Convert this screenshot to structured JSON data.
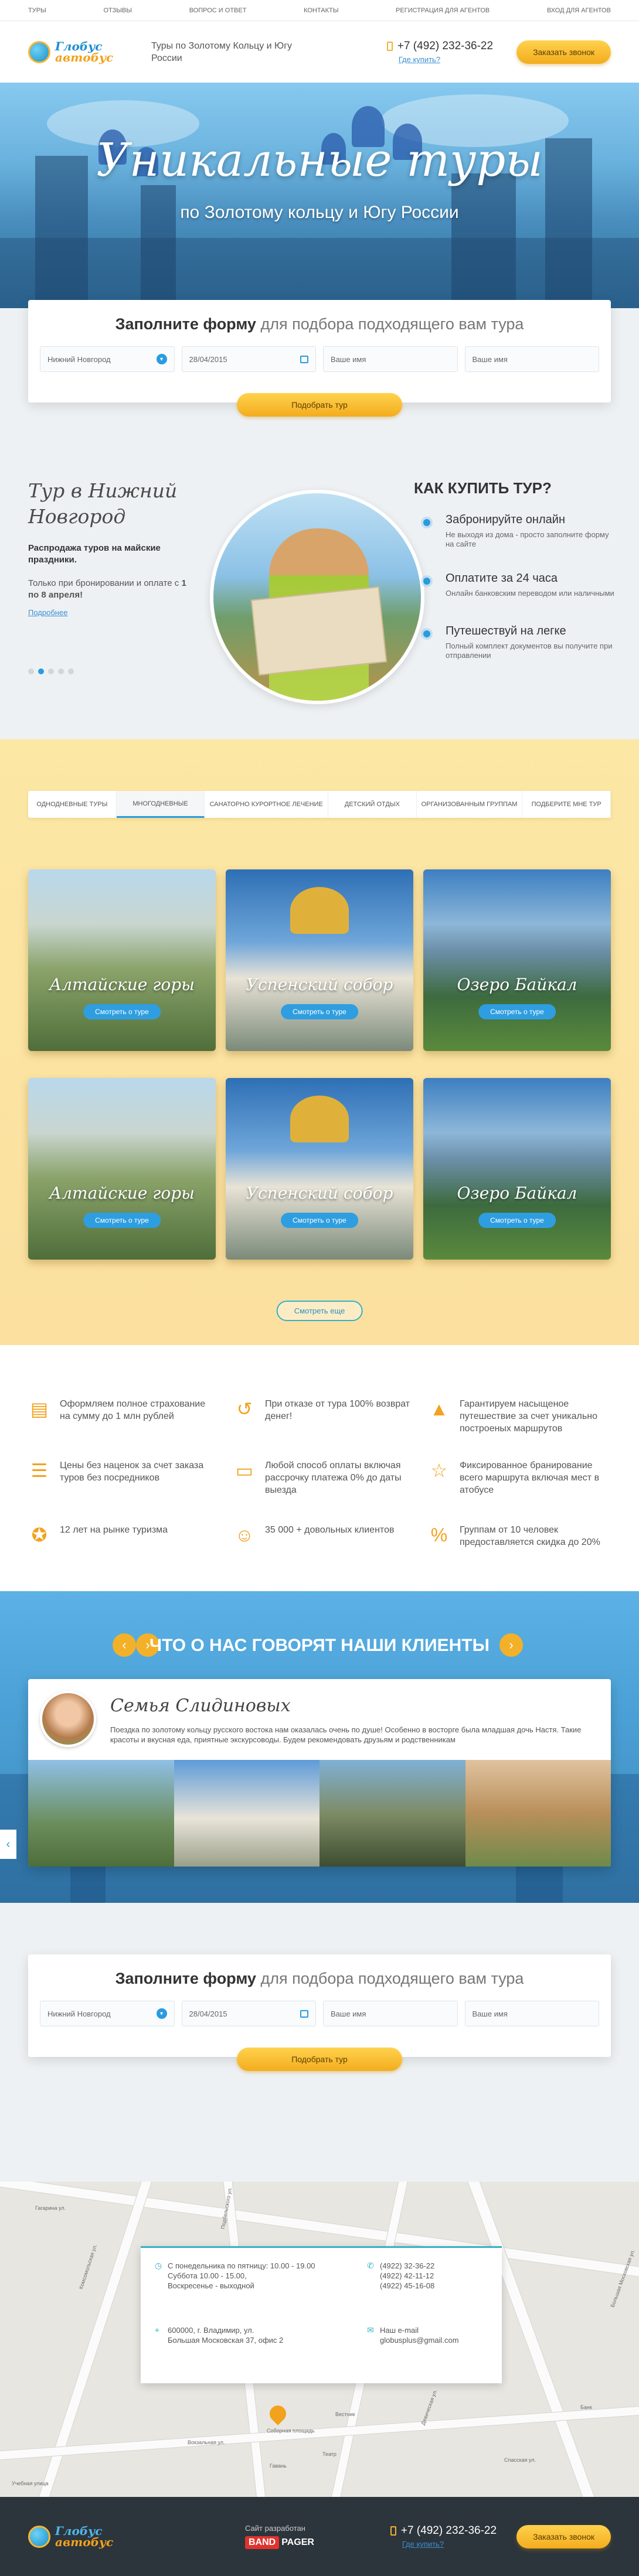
{
  "topnav": [
    "Туры",
    "Отзывы",
    "Вопрос и ответ",
    "Контакты",
    "Регистрация для агентов",
    "Вход для агентов"
  ],
  "header": {
    "logo_line1": "Глобус",
    "logo_line2": "автобус",
    "tagline": "Туры по Золотому Кольцу и Югу России",
    "phone": "+7 (492) 232-36-22",
    "where_link": "Где купить?",
    "callback": "Заказать звонок"
  },
  "hero": {
    "title": "Уникальные туры",
    "subtitle": "по Золотому кольцу и Югу России"
  },
  "form": {
    "title_bold": "Заполните форму",
    "title_rest": "для подбора подходящего вам тура",
    "city": "Нижний Новгород",
    "date": "28/04/2015",
    "name_placeholder": "Ваше имя",
    "name2_placeholder": "Ваше имя",
    "submit": "Подобрать тур"
  },
  "promo": {
    "title": "Тур в Нижний Новгород",
    "bold": "Распродажа туров на майские праздники.",
    "text_before": "Только при  бронировании и оплате с ",
    "text_bold": "1 по 8 апреля!",
    "link": "Подробнее",
    "how_title": "КАК КУПИТЬ ТУР?",
    "steps": [
      {
        "title": "Забронируйте онлайн",
        "desc": "Не выходя из дома - просто заполните форму на сайте"
      },
      {
        "title": "Оплатите за 24 часа",
        "desc": "Онлайн банковским переводом или наличными"
      },
      {
        "title": "Путешествуй на легке",
        "desc": "Полный комплект документов вы получите при отправлении"
      }
    ]
  },
  "tours": {
    "tabs": [
      "Однодневные туры",
      "Многодневные",
      "Санаторно курортное лечение",
      "Детский отдых",
      "Организованным группам",
      "Подберите мне тур"
    ],
    "active_tab": 1,
    "cards": [
      {
        "name": "Алтайские горы",
        "button": "Смотреть о туре"
      },
      {
        "name": "Успенский собор",
        "button": "Смотреть о туре"
      },
      {
        "name": "Озеро Байкал",
        "button": "Смотреть о туре"
      },
      {
        "name": "Алтайские горы",
        "button": "Смотреть о туре"
      },
      {
        "name": "Успенский собор",
        "button": "Смотреть о туре"
      },
      {
        "name": "Озеро Байкал",
        "button": "Смотреть о туре"
      }
    ],
    "more": "Смотреть еще"
  },
  "features": [
    {
      "icon": "document-icon",
      "text": "Оформляем полное страхование на сумму до 1 млн рублей"
    },
    {
      "icon": "refund-icon",
      "text": "При отказе от тура 100% возврат денег!"
    },
    {
      "icon": "mountain-icon",
      "text": "Гарантируем насыщеное путешествие за счет уникально построеных маршрутов"
    },
    {
      "icon": "receipt-icon",
      "text": "Цены без наценок за счет заказа туров без посредников"
    },
    {
      "icon": "wallet-icon",
      "text": "Любой способ оплаты включая рассрочку платежа 0% до даты выезда"
    },
    {
      "icon": "star-icon",
      "text": "Фиксированное бранирование всего маршрута включая мест в атобусе"
    },
    {
      "icon": "medal-icon",
      "text": "12 лет на рынке туризма"
    },
    {
      "icon": "smile-icon",
      "text": "35 000 + довольных клиентов"
    },
    {
      "icon": "percent-icon",
      "text": "Группам от 10 человек предоставляется скидка до 20%"
    }
  ],
  "reviews": {
    "title": "Что о нас говорят наши клиенты",
    "name": "Семья Слидиновых",
    "text": "Поездка по золотому кольцу русского востока нам оказалась очень по душе! Особенно в восторге была младшая дочь Настя. Такие красоты и вкусная еда, приятные экскурсоводы. Будем рекомендовать друзьям и родственникам"
  },
  "contacts": {
    "hours1": "С понедельника по пятницу: 10.00 - 19.00",
    "hours2": "Суббота 10.00 - 15.00,",
    "hours3": "Воскресенье - выходной",
    "address1": "600000, г. Владимир, ул.",
    "address2": "Большая Московская 37, офис 2",
    "phone1": "(4922) 32-36-22",
    "phone2": "(4922) 42-11-12",
    "phone3": "(4922) 45-16-08",
    "email_label": "Наш e-mail",
    "email": "globusplus@gmail.com"
  },
  "map_labels": [
    "Большая Московская ул.",
    "Комсомольская ул.",
    "Гагарина ул.",
    "Вокзальная ул.",
    "Девическая ул.",
    "Спасская ул.",
    "Подбельского ул.",
    "Соборная площадь",
    "Вестник",
    "Гавань",
    "Банк",
    "Театр",
    "Учебная улица"
  ],
  "footer": {
    "dev_label": "Сайт разработан",
    "dev_band": "BAND",
    "dev_pager": "PAGER",
    "phone": "+7 (492) 232-36-22",
    "where_link": "Где купить?",
    "callback": "Заказать звонок"
  }
}
